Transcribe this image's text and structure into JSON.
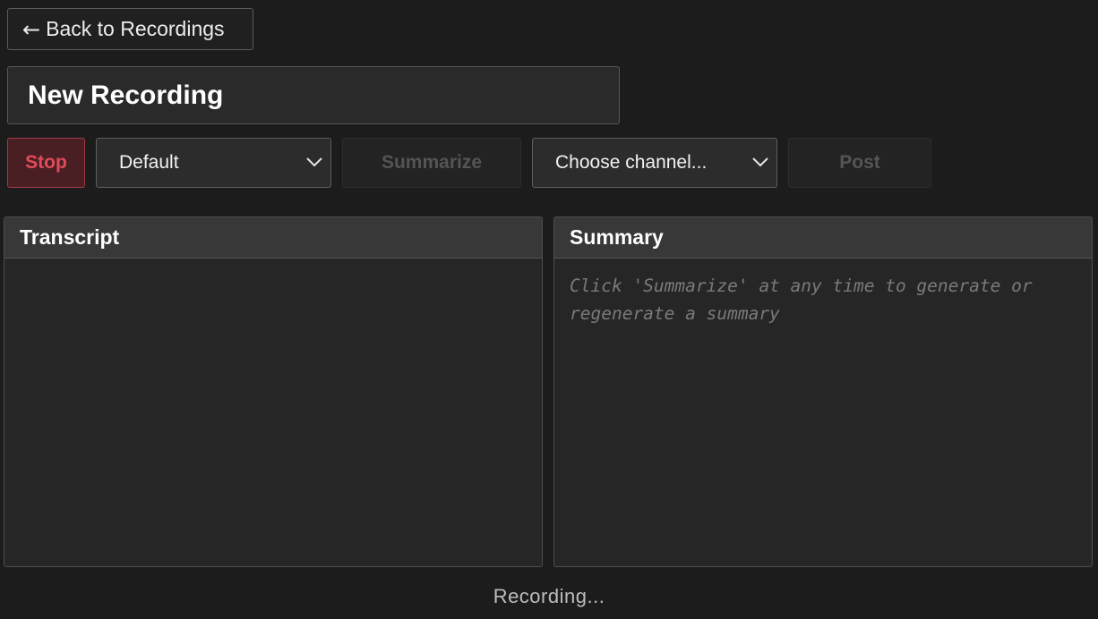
{
  "header": {
    "back_label": "Back to Recordings",
    "back_icon": "left-arrow-icon"
  },
  "recording": {
    "title": "New Recording"
  },
  "toolbar": {
    "stop_label": "Stop",
    "template_select_value": "Default",
    "summarize_label": "Summarize",
    "channel_select_value": "Choose channel...",
    "post_label": "Post"
  },
  "panels": {
    "transcript": {
      "title": "Transcript",
      "content": ""
    },
    "summary": {
      "title": "Summary",
      "placeholder": "Click 'Summarize' at any time to generate or regenerate a summary"
    }
  },
  "status": {
    "text": "Recording..."
  },
  "colors": {
    "background": "#1c1c1c",
    "stop_accent": "#e04c5a",
    "stop_bg": "#4a1f24",
    "panel_header": "#383838",
    "panel_body": "#262626"
  }
}
